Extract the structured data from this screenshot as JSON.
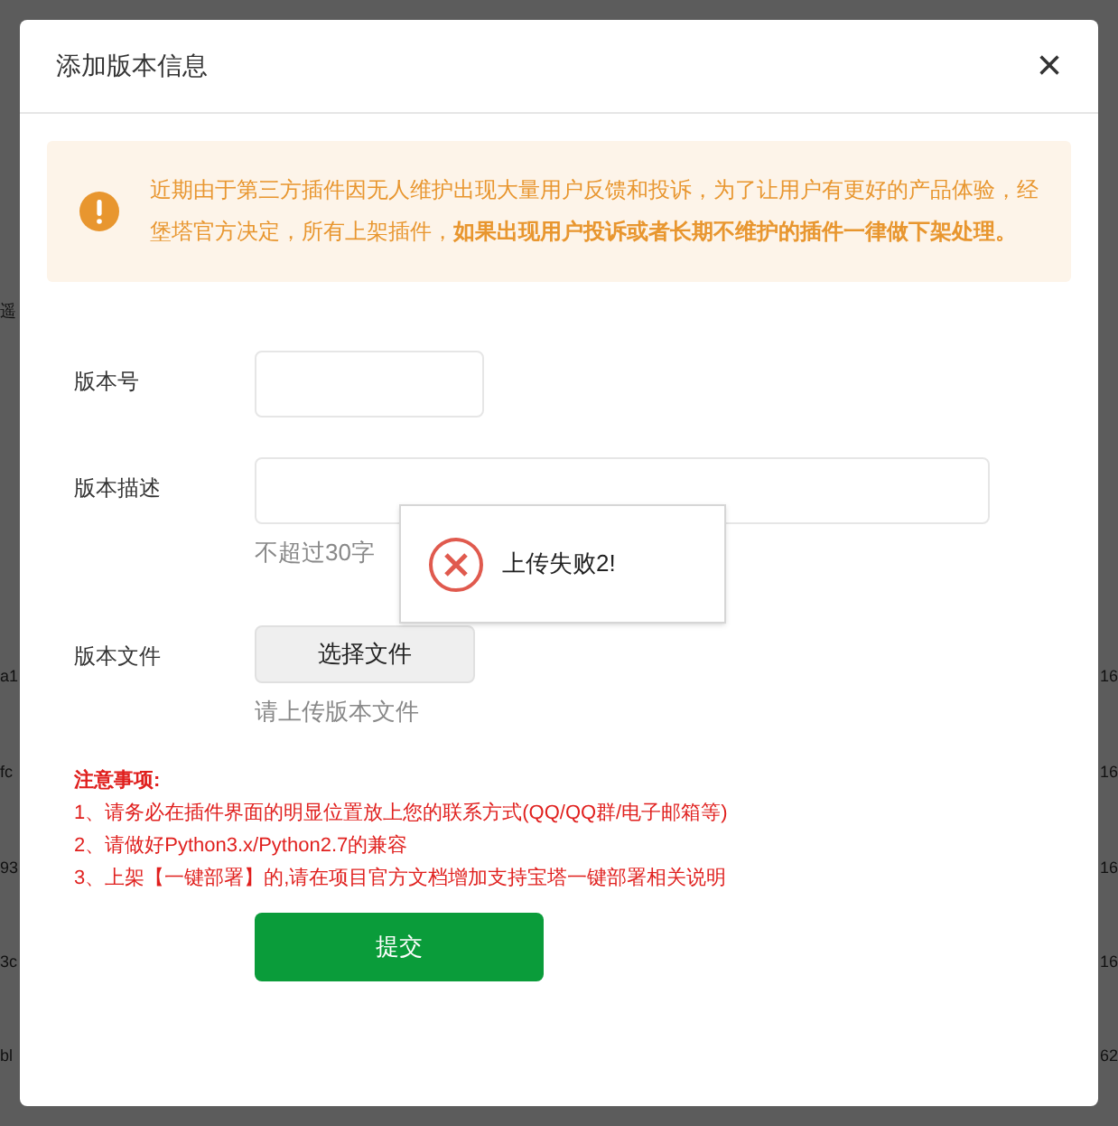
{
  "background": {
    "left_fragments": [
      "遥",
      "a1",
      "fc",
      "93",
      "3c",
      "bl"
    ],
    "right_fragments": [
      "16",
      "16",
      "16",
      "16",
      "62"
    ]
  },
  "dialog": {
    "title": "添加版本信息",
    "close": "×",
    "notice": {
      "text": "近期由于第三方插件因无人维护出现大量用户反馈和投诉，为了让用户有更好的产品体验，经堡塔官方决定，所有上架插件，**如果出现用户投诉或者长期不维护的插件一律做下架处理。**"
    },
    "fields": [
      {
        "kind": "short",
        "label": "版本号"
      },
      {
        "kind": "long",
        "label": "版本描述",
        "hint": "不超过30字"
      },
      {
        "kind": "file",
        "label": "版本文件",
        "button": "选择文件",
        "hint": "请上传版本文件"
      }
    ],
    "notes": {
      "title": "注意事项:",
      "items": [
        "1、请务必在插件界面的明显位置放上您的联系方式(QQ/QQ群/电子邮箱等)",
        "2、请做好Python3.x/Python2.7的兼容",
        "3、上架【一键部署】的,请在项目官方文档增加支持宝塔一键部署相关说明"
      ]
    },
    "submit": "提交"
  },
  "toast": {
    "kind": "error",
    "message": "上传失败2!"
  }
}
